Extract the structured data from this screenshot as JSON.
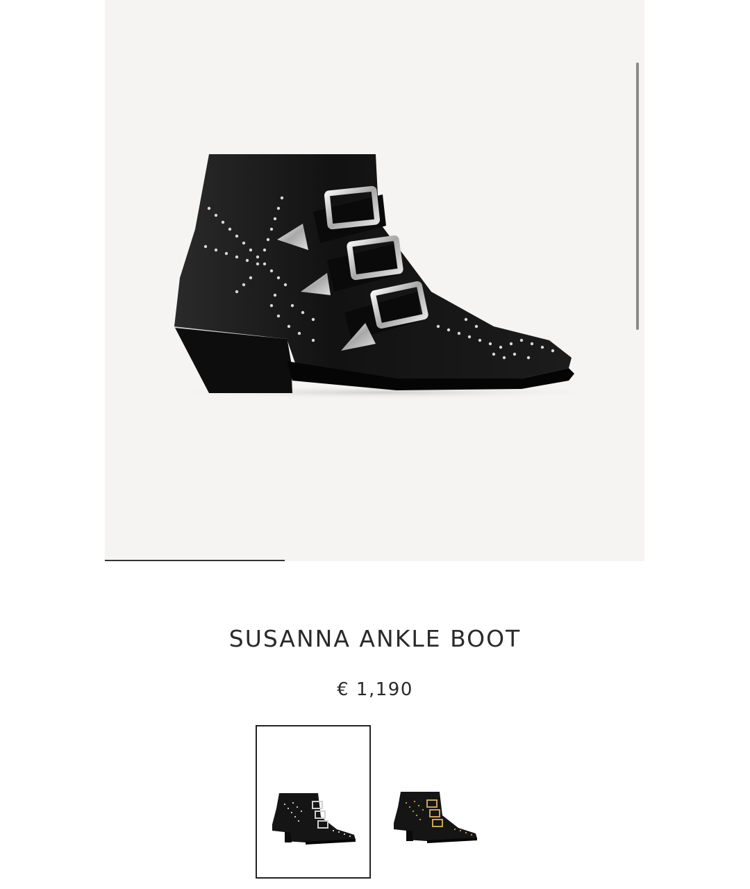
{
  "product": {
    "name": "SUSANNA ANKLE BOOT",
    "price": "€ 1,190"
  },
  "gallery": {
    "progress": 0.333,
    "main_image": "susanna-black-silver-boot"
  },
  "swatches": [
    {
      "name": "black-silver",
      "selected": true
    },
    {
      "name": "black-gold",
      "selected": false
    }
  ],
  "colors": {
    "gallery_bg": "#f5f4f2",
    "leather": "#141414",
    "silver_stud": "#d8d8d8",
    "gold_stud": "#c9a25a"
  }
}
